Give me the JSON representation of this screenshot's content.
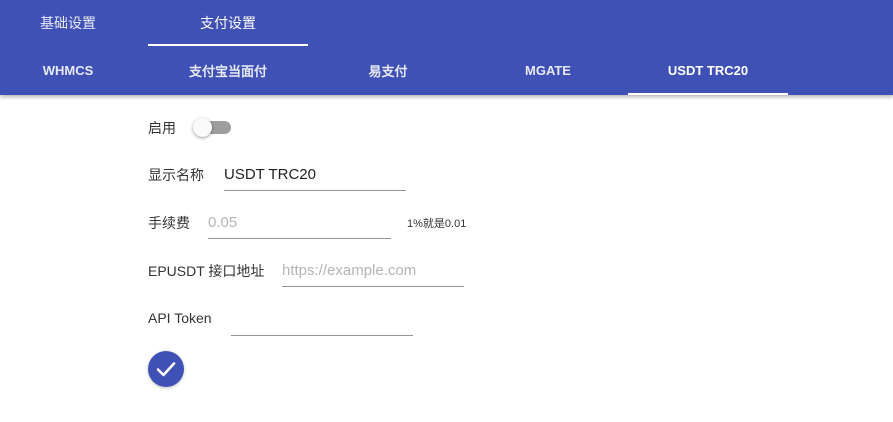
{
  "top_tabs": [
    {
      "label": "基础设置",
      "active": false
    },
    {
      "label": "支付设置",
      "active": true
    }
  ],
  "payment_tabs": [
    {
      "label": "WHMCS",
      "active": false
    },
    {
      "label": "支付宝当面付",
      "active": false
    },
    {
      "label": "易支付",
      "active": false
    },
    {
      "label": "MGATE",
      "active": false
    },
    {
      "label": "USDT TRC20",
      "active": true
    }
  ],
  "form": {
    "enable": {
      "label": "启用",
      "checked": false
    },
    "display_name": {
      "label": "显示名称",
      "value": "USDT TRC20",
      "placeholder": ""
    },
    "fee": {
      "label": "手续费",
      "value": "",
      "placeholder": "0.05",
      "hint": "1%就是0.01"
    },
    "api_url": {
      "label": "EPUSDT 接口地址",
      "value": "",
      "placeholder": "https://example.com"
    },
    "api_token": {
      "label": "API Token",
      "value": "",
      "placeholder": ""
    },
    "submit_icon": "check-icon"
  },
  "colors": {
    "primary": "#3f51b5",
    "switch_off_track": "#9e9e9e"
  }
}
